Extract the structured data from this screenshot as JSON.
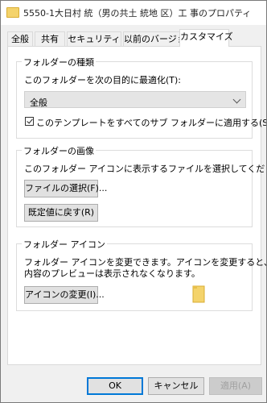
{
  "window": {
    "title": "5550-1大日村 統（男の共土 統地 区）工 事のプロパティ"
  },
  "tabs": [
    {
      "label": "全般"
    },
    {
      "label": "共有"
    },
    {
      "label": "セキュリティ"
    },
    {
      "label": "以前のバージョン"
    },
    {
      "label": "カスタマイズ",
      "active": true
    }
  ],
  "folder_type": {
    "group_title": "フォルダーの種類",
    "optimize_label": "このフォルダーを次の目的に最適化(T):",
    "optimize_value": "全般",
    "apply_template_label": "このテンプレートをすべてのサブ フォルダーに適用する(S)",
    "apply_template_checked": true
  },
  "folder_picture": {
    "group_title": "フォルダーの画像",
    "description": "このフォルダー アイコンに表示するファイルを選択してください。",
    "choose_file_button": "ファイルの選択(F)...",
    "restore_default_button": "既定値に戻す(R)"
  },
  "folder_icon": {
    "group_title": "フォルダー アイコン",
    "description_line1": "フォルダー アイコンを変更できます。アイコンを変更すると、フォルダーの",
    "description_line2": "内容のプレビューは表示されなくなります。",
    "change_icon_button": "アイコンの変更(I)..."
  },
  "footer": {
    "ok_button": "OK",
    "cancel_button": "キャンセル",
    "apply_button": "適用(A)"
  },
  "colors": {
    "accent": "#0078d7",
    "folder_fill": "#f4d36b",
    "folder_edge": "#d9ad33"
  }
}
